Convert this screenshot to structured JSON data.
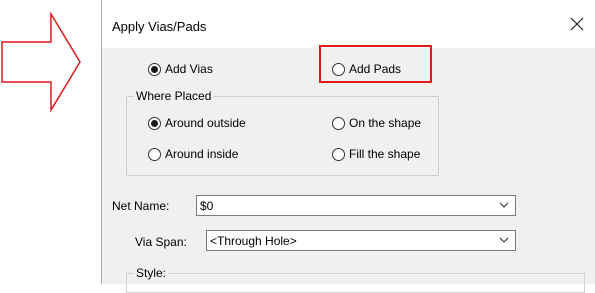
{
  "dialog": {
    "title": "Apply Vias/Pads",
    "mode": {
      "add_vias_label": "Add Vias",
      "add_pads_label": "Add Pads",
      "selected": "add_vias"
    },
    "where_placed": {
      "label": "Where Placed",
      "around_outside_label": "Around outside",
      "on_shape_label": "On the shape",
      "around_inside_label": "Around inside",
      "fill_shape_label": "Fill the shape",
      "selected": "around_outside"
    },
    "net_name": {
      "label": "Net Name:",
      "value": "$0"
    },
    "via_span": {
      "label": "Via Span:",
      "value": "<Through Hole>"
    },
    "style": {
      "label": "Style:"
    }
  },
  "colors": {
    "highlight": "#e01a1a",
    "arrow": "#e01a1a",
    "dialog_background": "#f0f0f0"
  },
  "icons": {
    "arrow": "callout-arrow-icon",
    "close": "close-icon",
    "dropdown": "chevron-down-icon"
  }
}
